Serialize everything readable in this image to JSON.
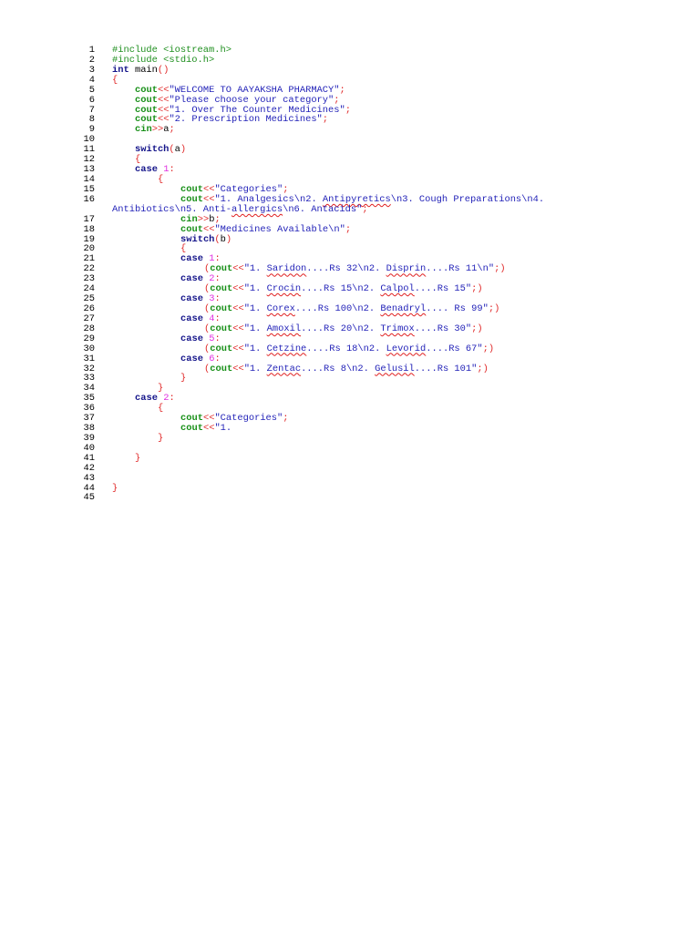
{
  "lines": [
    {
      "n": "1",
      "indent": 0,
      "tokens": [
        [
          "#include <iostream.h>",
          "pre"
        ]
      ]
    },
    {
      "n": "2",
      "indent": 0,
      "tokens": [
        [
          "#include <stdio.h>",
          "pre"
        ]
      ]
    },
    {
      "n": "3",
      "indent": 0,
      "tokens": [
        [
          "int",
          "kw"
        ],
        [
          " main",
          "pl"
        ],
        [
          "()",
          "op"
        ]
      ]
    },
    {
      "n": "4",
      "indent": 0,
      "tokens": [
        [
          "{",
          "op"
        ]
      ]
    },
    {
      "n": "5",
      "indent": 1,
      "tokens": [
        [
          "cout",
          "fn"
        ],
        [
          "<<",
          "op"
        ],
        [
          "\"WELCOME TO AAYAKSHA PHARMACY\"",
          "str"
        ],
        [
          ";",
          "op"
        ]
      ]
    },
    {
      "n": "6",
      "indent": 1,
      "tokens": [
        [
          "cout",
          "fn"
        ],
        [
          "<<",
          "op"
        ],
        [
          "\"Please choose your category\"",
          "str"
        ],
        [
          ";",
          "op"
        ]
      ]
    },
    {
      "n": "7",
      "indent": 1,
      "tokens": [
        [
          "cout",
          "fn"
        ],
        [
          "<<",
          "op"
        ],
        [
          "\"1. Over The Counter Medicines\"",
          "str"
        ],
        [
          ";",
          "op"
        ]
      ]
    },
    {
      "n": "8",
      "indent": 1,
      "tokens": [
        [
          "cout",
          "fn"
        ],
        [
          "<<",
          "op"
        ],
        [
          "\"2. Prescription Medicines\"",
          "str"
        ],
        [
          ";",
          "op"
        ]
      ]
    },
    {
      "n": "9",
      "indent": 1,
      "tokens": [
        [
          "cin",
          "fn"
        ],
        [
          ">>",
          "op"
        ],
        [
          "a",
          "pl"
        ],
        [
          ";",
          "op"
        ]
      ]
    },
    {
      "n": "10",
      "indent": 0,
      "tokens": []
    },
    {
      "n": "11",
      "indent": 1,
      "tokens": [
        [
          "switch",
          "kw"
        ],
        [
          "(",
          "op"
        ],
        [
          "a",
          "pl"
        ],
        [
          ")",
          "op"
        ]
      ]
    },
    {
      "n": "12",
      "indent": 1,
      "tokens": [
        [
          "{",
          "op"
        ]
      ]
    },
    {
      "n": "13",
      "indent": 1,
      "tokens": [
        [
          "case ",
          "kw"
        ],
        [
          "1",
          "num"
        ],
        [
          ":",
          "op"
        ]
      ]
    },
    {
      "n": "14",
      "indent": 2,
      "tokens": [
        [
          "{",
          "op"
        ]
      ]
    },
    {
      "n": "15",
      "indent": 3,
      "tokens": [
        [
          "cout",
          "fn"
        ],
        [
          "<<",
          "op"
        ],
        [
          "\"Categories\"",
          "str"
        ],
        [
          ";",
          "op"
        ]
      ]
    },
    {
      "n": "16",
      "indent": 3,
      "tokens": [
        [
          "cout",
          "fn"
        ],
        [
          "<<",
          "op"
        ],
        [
          "\"1. Analgesics\\n2. ",
          "str"
        ],
        [
          "Antipyretics",
          "sp"
        ],
        [
          "\\n3. Cough Preparations\\n4.",
          "str"
        ]
      ]
    },
    {
      "n": "",
      "indent": 0,
      "tokens": [
        [
          "Antibiotics\\n5. Anti-",
          "str"
        ],
        [
          "allergics",
          "sp"
        ],
        [
          "\\n6. Antacids\"",
          "str"
        ],
        [
          ";",
          "op"
        ]
      ]
    },
    {
      "n": "17",
      "indent": 3,
      "tokens": [
        [
          "cin",
          "fn"
        ],
        [
          ">>",
          "op"
        ],
        [
          "b",
          "pl"
        ],
        [
          ";",
          "op"
        ]
      ]
    },
    {
      "n": "18",
      "indent": 3,
      "tokens": [
        [
          "cout",
          "fn"
        ],
        [
          "<<",
          "op"
        ],
        [
          "\"Medicines Available\\n\"",
          "str"
        ],
        [
          ";",
          "op"
        ]
      ]
    },
    {
      "n": "19",
      "indent": 3,
      "tokens": [
        [
          "switch",
          "kw"
        ],
        [
          "(",
          "op"
        ],
        [
          "b",
          "pl"
        ],
        [
          ")",
          "op"
        ]
      ]
    },
    {
      "n": "20",
      "indent": 3,
      "tokens": [
        [
          "{",
          "op"
        ]
      ]
    },
    {
      "n": "21",
      "indent": 3,
      "tokens": [
        [
          "case ",
          "kw"
        ],
        [
          "1",
          "num"
        ],
        [
          ":",
          "op"
        ]
      ]
    },
    {
      "n": "22",
      "indent": 4,
      "tokens": [
        [
          "(",
          "op"
        ],
        [
          "cout",
          "fn"
        ],
        [
          "<<",
          "op"
        ],
        [
          "\"1. ",
          "str"
        ],
        [
          "Saridon",
          "sp"
        ],
        [
          "....Rs 32\\n2. ",
          "str"
        ],
        [
          "Disprin",
          "sp"
        ],
        [
          "....Rs 11\\n\"",
          "str"
        ],
        [
          ";)",
          "op"
        ]
      ]
    },
    {
      "n": "23",
      "indent": 3,
      "tokens": [
        [
          "case ",
          "kw"
        ],
        [
          "2",
          "num"
        ],
        [
          ":",
          "op"
        ]
      ]
    },
    {
      "n": "24",
      "indent": 4,
      "tokens": [
        [
          "(",
          "op"
        ],
        [
          "cout",
          "fn"
        ],
        [
          "<<",
          "op"
        ],
        [
          "\"1. ",
          "str"
        ],
        [
          "Crocin",
          "sp"
        ],
        [
          "....Rs 15\\n2. ",
          "str"
        ],
        [
          "Calpol",
          "sp"
        ],
        [
          "....Rs 15\"",
          "str"
        ],
        [
          ";)",
          "op"
        ]
      ]
    },
    {
      "n": "25",
      "indent": 3,
      "tokens": [
        [
          "case ",
          "kw"
        ],
        [
          "3",
          "num"
        ],
        [
          ":",
          "op"
        ]
      ]
    },
    {
      "n": "26",
      "indent": 4,
      "tokens": [
        [
          "(",
          "op"
        ],
        [
          "cout",
          "fn"
        ],
        [
          "<<",
          "op"
        ],
        [
          "\"1. ",
          "str"
        ],
        [
          "Corex",
          "sp"
        ],
        [
          "....Rs 100\\n2. ",
          "str"
        ],
        [
          "Benadryl",
          "sp"
        ],
        [
          ".... Rs 99\"",
          "str"
        ],
        [
          ";)",
          "op"
        ]
      ]
    },
    {
      "n": "27",
      "indent": 3,
      "tokens": [
        [
          "case ",
          "kw"
        ],
        [
          "4",
          "num"
        ],
        [
          ":",
          "op"
        ]
      ]
    },
    {
      "n": "28",
      "indent": 4,
      "tokens": [
        [
          "(",
          "op"
        ],
        [
          "cout",
          "fn"
        ],
        [
          "<<",
          "op"
        ],
        [
          "\"1. ",
          "str"
        ],
        [
          "Amoxil",
          "sp"
        ],
        [
          "....Rs 20\\n2. ",
          "str"
        ],
        [
          "Trimox",
          "sp"
        ],
        [
          "....Rs 30\"",
          "str"
        ],
        [
          ";)",
          "op"
        ]
      ]
    },
    {
      "n": "29",
      "indent": 3,
      "tokens": [
        [
          "case ",
          "kw"
        ],
        [
          "5",
          "num"
        ],
        [
          ":",
          "op"
        ]
      ]
    },
    {
      "n": "30",
      "indent": 4,
      "tokens": [
        [
          "(",
          "op"
        ],
        [
          "cout",
          "fn"
        ],
        [
          "<<",
          "op"
        ],
        [
          "\"1. ",
          "str"
        ],
        [
          "Cetzine",
          "sp"
        ],
        [
          "....Rs 18\\n2. ",
          "str"
        ],
        [
          "Levorid",
          "sp"
        ],
        [
          "....Rs 67\"",
          "str"
        ],
        [
          ";)",
          "op"
        ]
      ]
    },
    {
      "n": "31",
      "indent": 3,
      "tokens": [
        [
          "case ",
          "kw"
        ],
        [
          "6",
          "num"
        ],
        [
          ":",
          "op"
        ]
      ]
    },
    {
      "n": "32",
      "indent": 4,
      "tokens": [
        [
          "(",
          "op"
        ],
        [
          "cout",
          "fn"
        ],
        [
          "<<",
          "op"
        ],
        [
          "\"1. ",
          "str"
        ],
        [
          "Zentac",
          "sp"
        ],
        [
          "....Rs 8\\n2. ",
          "str"
        ],
        [
          "Gelusil",
          "sp"
        ],
        [
          "....Rs 101\"",
          "str"
        ],
        [
          ";)",
          "op"
        ]
      ]
    },
    {
      "n": "33",
      "indent": 3,
      "tokens": [
        [
          "}",
          "op"
        ]
      ]
    },
    {
      "n": "34",
      "indent": 2,
      "tokens": [
        [
          "}",
          "op"
        ]
      ]
    },
    {
      "n": "35",
      "indent": 1,
      "tokens": [
        [
          "case ",
          "kw"
        ],
        [
          "2",
          "num"
        ],
        [
          ":",
          "op"
        ]
      ]
    },
    {
      "n": "36",
      "indent": 2,
      "tokens": [
        [
          "{",
          "op"
        ]
      ]
    },
    {
      "n": "37",
      "indent": 3,
      "tokens": [
        [
          "cout",
          "fn"
        ],
        [
          "<<",
          "op"
        ],
        [
          "\"Categories\"",
          "str"
        ],
        [
          ";",
          "op"
        ]
      ]
    },
    {
      "n": "38",
      "indent": 3,
      "tokens": [
        [
          "cout",
          "fn"
        ],
        [
          "<<",
          "op"
        ],
        [
          "\"1.",
          "str"
        ]
      ]
    },
    {
      "n": "39",
      "indent": 2,
      "tokens": [
        [
          "}",
          "op"
        ]
      ]
    },
    {
      "n": "40",
      "indent": 0,
      "tokens": []
    },
    {
      "n": "41",
      "indent": 1,
      "tokens": [
        [
          "}",
          "op"
        ]
      ]
    },
    {
      "n": "42",
      "indent": 0,
      "tokens": []
    },
    {
      "n": "43",
      "indent": 0,
      "tokens": []
    },
    {
      "n": "44",
      "indent": 0,
      "tokens": [
        [
          "}",
          "op"
        ]
      ]
    },
    {
      "n": "45",
      "indent": 0,
      "tokens": []
    }
  ]
}
